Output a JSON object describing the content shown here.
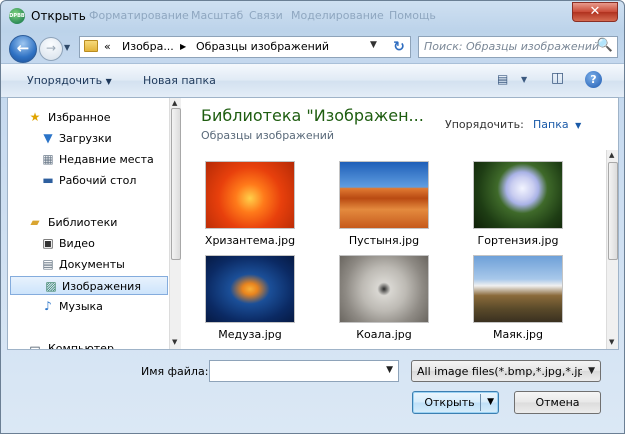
{
  "window": {
    "title": "Открыть",
    "app_icon_text": "DPBB",
    "close_label": "✕"
  },
  "ghost_menu": [
    "Форматирование",
    "Масштаб",
    "Связи",
    "Моделирование",
    "Помощь"
  ],
  "nav": {
    "back": "←",
    "forward": "→",
    "dropdown": "▼",
    "breadcrumb": {
      "overflow": "«",
      "items": [
        "Изобра...",
        "Образцы изображений"
      ],
      "separator": "▶",
      "dropdown": "▼"
    },
    "refresh": "↻",
    "search_placeholder": "Поиск: Образцы изображений",
    "search_icon": "🔍"
  },
  "toolbar": {
    "organize": "Упорядочить",
    "new_folder": "Новая папка",
    "dropdown": "▼",
    "views_icon": "▤",
    "pane_icon": "◫",
    "help": "?"
  },
  "sidebar": {
    "items": [
      {
        "label": "Избранное",
        "icon": "star-icon",
        "glyph": "★",
        "color": "#e0a400",
        "top": true
      },
      {
        "label": "Загрузки",
        "icon": "downloads-folder-icon",
        "glyph": "▼",
        "color": "#2b74c8",
        "top": false
      },
      {
        "label": "Недавние места",
        "icon": "recent-places-icon",
        "glyph": "▦",
        "color": "#6b7a8a",
        "top": false
      },
      {
        "label": "Рабочий стол",
        "icon": "desktop-icon",
        "glyph": "▬",
        "color": "#2e5f9e",
        "top": false
      },
      {
        "label": "Библиотеки",
        "icon": "libraries-icon",
        "glyph": "▰",
        "color": "#d9a531",
        "top": true
      },
      {
        "label": "Видео",
        "icon": "video-library-icon",
        "glyph": "▣",
        "color": "#333333",
        "top": false
      },
      {
        "label": "Документы",
        "icon": "documents-library-icon",
        "glyph": "▤",
        "color": "#5a6a7a",
        "top": false
      },
      {
        "label": "Изображения",
        "icon": "pictures-library-icon",
        "glyph": "▨",
        "color": "#2f7a5a",
        "top": false,
        "selected": true
      },
      {
        "label": "Музыка",
        "icon": "music-library-icon",
        "glyph": "♪",
        "color": "#2b74c8",
        "top": false
      },
      {
        "label": "Компьютер",
        "icon": "computer-icon",
        "glyph": "▭",
        "color": "#3a4a5a",
        "top": true
      }
    ]
  },
  "main": {
    "title": "Библиотека \"Изображен...",
    "subtitle": "Образцы изображений",
    "arrange_label": "Упорядочить:",
    "arrange_value": "Папка",
    "arrange_dropdown": "▼",
    "files": [
      {
        "name": "Хризантема.jpg",
        "gradient": "radial-gradient(circle at 50% 55%,#ffd04a 0%,#ff7a1a 25%,#e8400c 55%,#b52a06 100%)"
      },
      {
        "name": "Пустыня.jpg",
        "gradient": "linear-gradient(#1f5fb8 0%,#5f9de0 38%,#e07a32 40%,#b94a12 55%,#e48a3e 72%,#c65a1c 100%)"
      },
      {
        "name": "Гортензия.jpg",
        "gradient": "radial-gradient(circle at 55% 40%,#f2f4ff 0%,#c9cdf0 18%,#a9b2e6 26%,#3f6a2a 40%,#1e3d14 70%,#0f2008 100%)"
      },
      {
        "name": "Медуза.jpg",
        "gradient": "radial-gradient(ellipse at 50% 50%,#f7b03a 0%,#e8841e 12%,#1b4f98 32%,#0b2a64 70%,#061a44 100%)"
      },
      {
        "name": "Коала.jpg",
        "gradient": "radial-gradient(circle at 50% 50%,#2a2a2a 0%,#d9d7d2 12%,#bdbab4 40%,#8e8a84 70%,#6a6660 100%)"
      },
      {
        "name": "Маяк.jpg",
        "gradient": "linear-gradient(#6ea0d8 0%,#a8c8ea 35%,#f0f0f0 45%,#8a6a3a 60%,#5a4a2a 80%,#3a3020 100%)"
      },
      {
        "name": "",
        "gradient": "linear-gradient(#9ec2e8,#dbe9f7)"
      },
      {
        "name": "",
        "gradient": "linear-gradient(#9ec2e8,#dbe9f7)"
      },
      {
        "name": "",
        "gradient": "linear-gradient(#dfe9f3,#ffffff)"
      }
    ]
  },
  "footer": {
    "filename_label": "Имя файла:",
    "filename_value": "",
    "filetype_value": "All image files(*.bmp,*.jpg,*.jpeg",
    "open_label": "Открыть",
    "cancel_label": "Отмена"
  },
  "colors": {
    "title_green": "#1e5d10",
    "link_blue": "#1a5aa8"
  }
}
